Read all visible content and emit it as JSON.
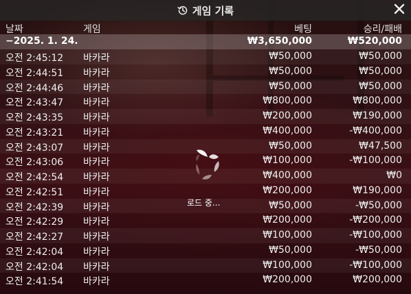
{
  "header": {
    "title": "게임 기록",
    "history_icon": "history-icon",
    "close_icon": "close-icon"
  },
  "columns": {
    "date": "날짜",
    "game": "게임",
    "bet": "베팅",
    "result": "승리/패배"
  },
  "summary": {
    "date": "−2025. 1. 24.",
    "bet": "₩3,650,000",
    "result": "₩520,000"
  },
  "rows": [
    {
      "time": "오전 2:45:12",
      "game": "바카라",
      "bet": "₩50,000",
      "result": "₩50,000"
    },
    {
      "time": "오전 2:44:51",
      "game": "바카라",
      "bet": "₩50,000",
      "result": "₩50,000"
    },
    {
      "time": "오전 2:44:46",
      "game": "바카라",
      "bet": "₩50,000",
      "result": "₩50,000"
    },
    {
      "time": "오전 2:43:47",
      "game": "바카라",
      "bet": "₩800,000",
      "result": "₩800,000"
    },
    {
      "time": "오전 2:43:35",
      "game": "바카라",
      "bet": "₩200,000",
      "result": "₩190,000"
    },
    {
      "time": "오전 2:43:21",
      "game": "바카라",
      "bet": "₩400,000",
      "result": "-₩400,000"
    },
    {
      "time": "오전 2:43:07",
      "game": "바카라",
      "bet": "₩50,000",
      "result": "₩47,500"
    },
    {
      "time": "오전 2:43:06",
      "game": "바카라",
      "bet": "₩100,000",
      "result": "-₩100,000"
    },
    {
      "time": "오전 2:42:54",
      "game": "바카라",
      "bet": "₩400,000",
      "result": "₩0"
    },
    {
      "time": "오전 2:42:51",
      "game": "바카라",
      "bet": "₩200,000",
      "result": "₩190,000"
    },
    {
      "time": "오전 2:42:39",
      "game": "바카라",
      "bet": "₩50,000",
      "result": "-₩50,000"
    },
    {
      "time": "오전 2:42:29",
      "game": "바카라",
      "bet": "₩200,000",
      "result": "-₩200,000"
    },
    {
      "time": "오전 2:42:27",
      "game": "바카라",
      "bet": "₩100,000",
      "result": "-₩100,000"
    },
    {
      "time": "오전 2:42:04",
      "game": "바카라",
      "bet": "₩50,000",
      "result": "-₩50,000"
    },
    {
      "time": "오전 2:42:04",
      "game": "바카라",
      "bet": "₩100,000",
      "result": "-₩100,000"
    },
    {
      "time": "오전 2:41:54",
      "game": "바카라",
      "bet": "₩200,000",
      "result": "₩200,000"
    }
  ],
  "loading": {
    "text": "로드 중...",
    "icon": "loading-spinner-icon"
  }
}
